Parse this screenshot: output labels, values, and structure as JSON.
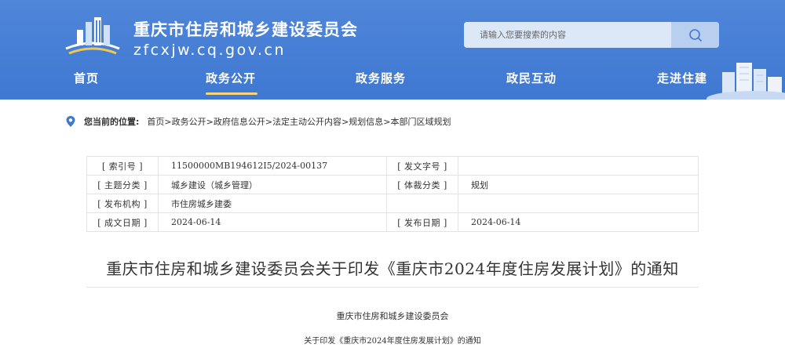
{
  "header": {
    "site_title": "重庆市住房和城乡建设委员会",
    "site_domain": "zfcxjw.cq.gov.cn",
    "search_placeholder": "请输入您要搜索的内容",
    "nav": [
      "首页",
      "政务公开",
      "政务服务",
      "政民互动",
      "走进住建"
    ],
    "active_nav": "政务公开",
    "accent_color": "#4f86d9",
    "underline_color": "#f6d479"
  },
  "breadcrumb": {
    "label": "您当前的位置:",
    "items": [
      "首页",
      "政务公开",
      "政府信息公开",
      "法定主动公开内容",
      "规划信息",
      "本部门区域规划"
    ],
    "separator": ">"
  },
  "meta": {
    "rows": [
      [
        "[ 索引号 ]",
        "11500000MB194612I5/2024-00137",
        "[ 发文字号 ]",
        ""
      ],
      [
        "[ 主题分类 ]",
        "城乡建设（城乡管理）",
        "[ 体裁分类 ]",
        "规划"
      ],
      [
        "[ 发布机构 ]",
        "市住房城乡建委",
        "",
        ""
      ],
      [
        "[ 成文日期 ]",
        "2024-06-14",
        "[ 发布日期 ]",
        "2024-06-14"
      ]
    ]
  },
  "document": {
    "title": "重庆市住房和城乡建设委员会关于印发《重庆市2024年度住房发展计划》的通知",
    "issuer": "重庆市住房和城乡建设委员会",
    "subtitle": "关于印发《重庆市2024年度住房发展计划》的通知"
  }
}
